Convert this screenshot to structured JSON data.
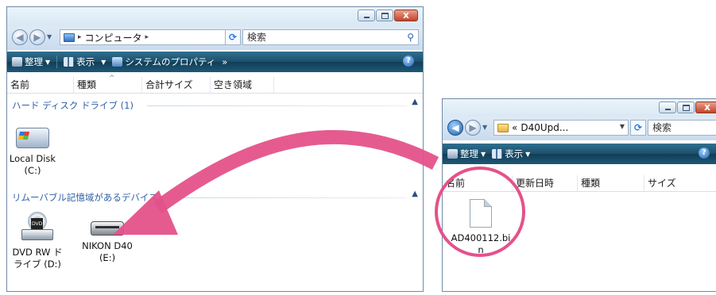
{
  "window1": {
    "address": {
      "crumb_separator": "▸",
      "location": "コンピュータ",
      "trail_arrow": "▸"
    },
    "search_placeholder": "検索",
    "toolbar": {
      "organize": "整理",
      "views": "表示",
      "system_properties": "システムのプロパティ",
      "more": "»"
    },
    "columns": [
      "名前",
      "種類",
      "合計サイズ",
      "空き領域"
    ],
    "groups": [
      {
        "label": "ハード ディスク ドライブ (1)"
      },
      {
        "label": "リムーバブル記憶域があるデバイス"
      }
    ],
    "drives": [
      {
        "label_line1": "Local Disk",
        "label_line2": "(C:)",
        "icon": "hard-disk-icon"
      },
      {
        "label_line1": "DVD RW ド",
        "label_line2": "ライブ (D:)",
        "icon": "dvd-drive-icon"
      },
      {
        "label_line1": "NIKON D40",
        "label_line2": "(E:)",
        "icon": "camera-drive-icon"
      }
    ]
  },
  "window2": {
    "address": {
      "prefix": "«",
      "location": "D40Upd..."
    },
    "search_placeholder": "検索",
    "toolbar": {
      "organize": "整理",
      "views": "表示"
    },
    "columns": [
      "名前",
      "更新日時",
      "種類",
      "サイズ"
    ],
    "file": {
      "name_line1": "AD400112.bi",
      "name_line2": "n"
    }
  },
  "window_controls": {
    "close_glyph": "x"
  },
  "icons": {
    "back": "back-arrow-icon",
    "forward": "forward-arrow-icon",
    "refresh": "refresh-icon",
    "search": "magnifier-icon",
    "help": "help-icon",
    "file": "bin-file-icon"
  },
  "colors": {
    "arrow": "#e4528a",
    "toolbar": "#1c4f6b",
    "group_text": "#2e5fa6",
    "close_button": "#c3432b"
  }
}
